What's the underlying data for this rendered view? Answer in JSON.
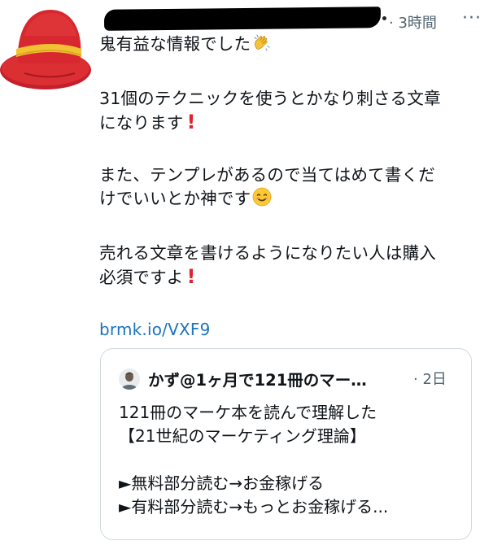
{
  "tweet": {
    "timestamp": "· 3時間",
    "more_label": "···",
    "lines": {
      "l1": "鬼有益な情報でした",
      "l2": "31個のテクニックを使うとかなり刺さる文章",
      "l3": "になります",
      "l4": "また、テンプレがあるので当てはめて書くだ",
      "l5": "けでいいとか神です",
      "l6": "売れる文章を書けるようになりたい人は購入",
      "l7": "必須ですよ"
    },
    "link": "brmk.io/VXF9",
    "icons": [
      "clapping-hands-emoji",
      "exclamation-emoji",
      "smiling-face-emoji"
    ]
  },
  "quoted": {
    "name": "かず@1ヶ月で121冊のマー…",
    "time": "· 2日",
    "lines": {
      "q1": "121冊のマーケ本を読んで理解した",
      "q2": "【21世紀のマーケティング理論】",
      "q3": "►無料部分読む→お金稼げる",
      "q4": "►有料部分読む→もっとお金稼げる..."
    }
  },
  "colors": {
    "link": "#1d74bd",
    "meta_gray": "#536471",
    "border": "#cfd9de",
    "exclamation": "#e0232e"
  }
}
